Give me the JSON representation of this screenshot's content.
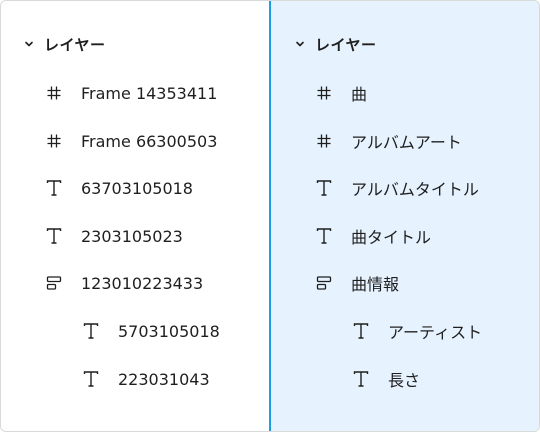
{
  "left_panel": {
    "header": "レイヤー",
    "items": [
      {
        "icon": "frame-icon",
        "label": "Frame 14353411"
      },
      {
        "icon": "frame-icon",
        "label": "Frame 66300503"
      },
      {
        "icon": "text-icon",
        "label": "63703105018"
      },
      {
        "icon": "text-icon",
        "label": "2303105023"
      },
      {
        "icon": "auto-layout-icon",
        "label": "123010223433"
      },
      {
        "icon": "text-icon",
        "label": "5703105018"
      },
      {
        "icon": "text-icon",
        "label": "223031043"
      }
    ]
  },
  "right_panel": {
    "header": "レイヤー",
    "items": [
      {
        "icon": "frame-icon",
        "label": "曲"
      },
      {
        "icon": "frame-icon",
        "label": "アルバムアート"
      },
      {
        "icon": "text-icon",
        "label": "アルバムタイトル"
      },
      {
        "icon": "text-icon",
        "label": "曲タイトル"
      },
      {
        "icon": "auto-layout-icon",
        "label": "曲情報"
      },
      {
        "icon": "text-icon",
        "label": "アーティスト"
      },
      {
        "icon": "text-icon",
        "label": "長さ"
      }
    ]
  },
  "colors": {
    "selected_background": "#e6f2fd",
    "divider": "#1a9fe6",
    "text": "#1f1f1f"
  }
}
